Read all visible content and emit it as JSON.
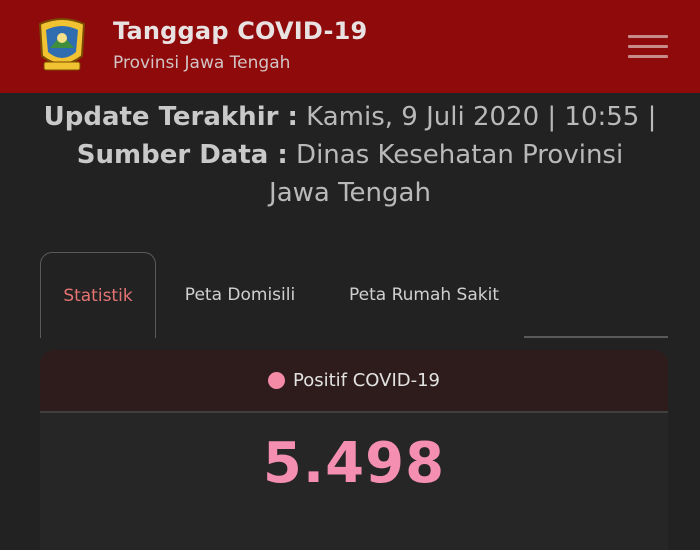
{
  "header": {
    "title": "Tanggap COVID-19",
    "subtitle": "Provinsi Jawa Tengah",
    "logo_icon": "jawa-tengah-emblem",
    "menu_icon": "hamburger-menu-icon"
  },
  "info": {
    "update_label": "Update Terakhir :",
    "update_value": "Kamis, 9 Juli 2020 | 10:55 |",
    "source_label": "Sumber Data :",
    "source_value_1": "Dinas Kesehatan Provinsi",
    "source_value_2": "Jawa Tengah"
  },
  "tabs": [
    {
      "label": "Statistik",
      "active": true
    },
    {
      "label": "Peta Domisili",
      "active": false
    },
    {
      "label": "Peta Rumah Sakit",
      "active": false
    }
  ],
  "card": {
    "label": "Positif COVID-19",
    "value": "5.498",
    "dot_color": "#f38aa6"
  },
  "colors": {
    "header_bg": "#8f0a0a",
    "page_bg": "#222222",
    "accent": "#f48fb1",
    "active_tab": "#e57373"
  }
}
